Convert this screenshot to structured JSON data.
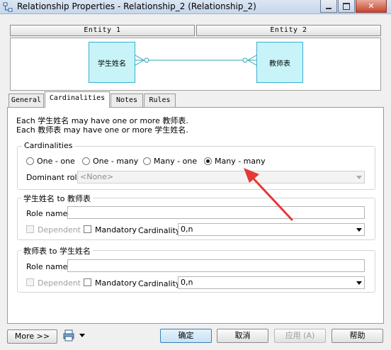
{
  "window": {
    "title": "Relationship Properties - Relationship_2 (Relationship_2)"
  },
  "header": {
    "entity1_label": "Entity 1",
    "entity2_label": "Entity 2"
  },
  "diagram": {
    "entity1_name": "学生姓名",
    "entity2_name": "教师表"
  },
  "tabs": [
    {
      "label": "General"
    },
    {
      "label": "Cardinalities"
    },
    {
      "label": "Notes"
    },
    {
      "label": "Rules"
    }
  ],
  "description": {
    "line1": "Each 学生姓名 may have one or more 教师表.",
    "line2": "Each 教师表 may have one or more 学生姓名."
  },
  "cardinalities": {
    "legend": "Cardinalities",
    "options": [
      "One - one",
      "One - many",
      "Many - one",
      "Many - many"
    ],
    "selected": "Many - many",
    "dominant_role_label": "Dominant role:",
    "dominant_role_value": "<None>"
  },
  "role1": {
    "legend": "学生姓名 to 教师表",
    "role_name_label": "Role name:",
    "role_name_value": "",
    "dependent_label": "Dependent",
    "mandatory_label": "Mandatory",
    "cardinality_label": "Cardinality:",
    "cardinality_value": "0,n"
  },
  "role2": {
    "legend": "教师表 to 学生姓名",
    "role_name_label": "Role name:",
    "role_name_value": "",
    "dependent_label": "Dependent",
    "mandatory_label": "Mandatory",
    "cardinality_label": "Cardinality:",
    "cardinality_value": "0,n"
  },
  "footer": {
    "more_label": "More >>",
    "ok_label": "确定",
    "cancel_label": "取消",
    "apply_label": "应用 (A)",
    "help_label": "帮助"
  },
  "icons": {
    "app": "relationship-icon",
    "minimize": "minimize-icon",
    "maximize": "maximize-icon",
    "close": "close-icon",
    "menu": "printer-icon"
  },
  "colors": {
    "entity_fill": "#c8f4f9",
    "entity_border": "#3aaed0",
    "relation_line": "#2aa7b8",
    "annotation_arrow": "#e53935"
  }
}
